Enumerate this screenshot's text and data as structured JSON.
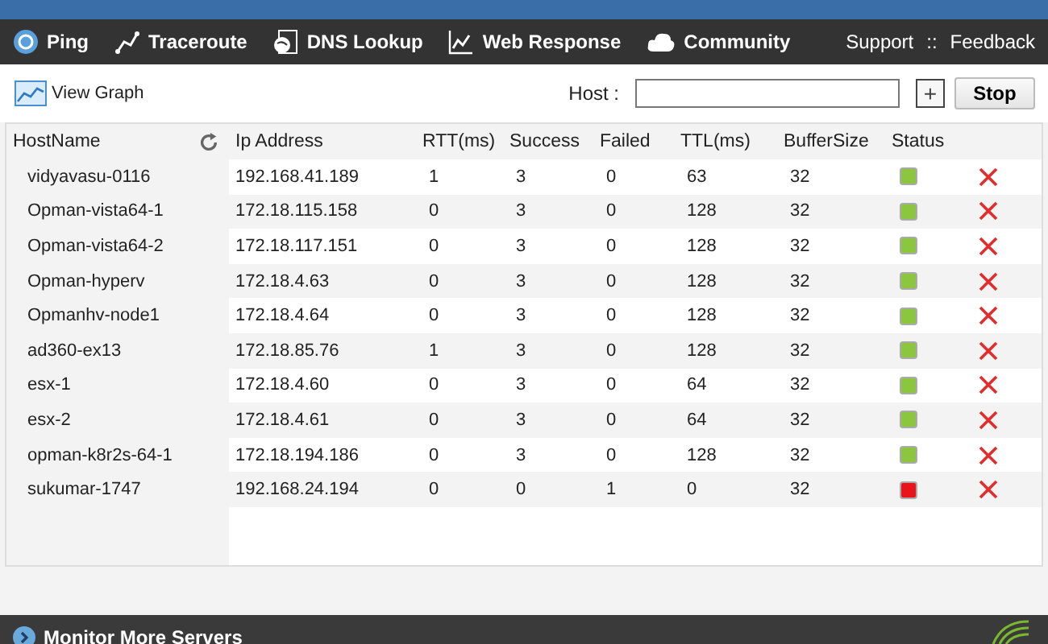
{
  "nav": {
    "items": [
      {
        "label": "Ping"
      },
      {
        "label": "Traceroute"
      },
      {
        "label": "DNS Lookup"
      },
      {
        "label": "Web Response"
      },
      {
        "label": "Community"
      }
    ],
    "links": [
      "Support",
      "::",
      "Feedback"
    ]
  },
  "toolbar": {
    "view_graph": "View Graph",
    "host_label": "Host :",
    "add": "+",
    "stop": "Stop"
  },
  "table": {
    "columns": [
      "HostName",
      "Ip Address",
      "RTT(ms)",
      "Success",
      "Failed",
      "TTL(ms)",
      "BufferSize",
      "Status"
    ],
    "rows": [
      {
        "host": "vidyavasu-0116",
        "ip": "192.168.41.189",
        "rtt": "1",
        "success": "3",
        "failed": "0",
        "ttl": "63",
        "buffer": "32",
        "color": "#8cc63f"
      },
      {
        "host": "Opman-vista64-1",
        "ip": "172.18.115.158",
        "rtt": "0",
        "success": "3",
        "failed": "0",
        "ttl": "128",
        "buffer": "32",
        "color": "#8cc63f"
      },
      {
        "host": "Opman-vista64-2",
        "ip": "172.18.117.151",
        "rtt": "0",
        "success": "3",
        "failed": "0",
        "ttl": "128",
        "buffer": "32",
        "color": "#8cc63f"
      },
      {
        "host": "Opman-hyperv",
        "ip": "172.18.4.63",
        "rtt": "0",
        "success": "3",
        "failed": "0",
        "ttl": "128",
        "buffer": "32",
        "color": "#8cc63f"
      },
      {
        "host": "Opmanhv-node1",
        "ip": "172.18.4.64",
        "rtt": "0",
        "success": "3",
        "failed": "0",
        "ttl": "128",
        "buffer": "32",
        "color": "#8cc63f"
      },
      {
        "host": "ad360-ex13",
        "ip": "172.18.85.76",
        "rtt": "1",
        "success": "3",
        "failed": "0",
        "ttl": "128",
        "buffer": "32",
        "color": "#8cc63f"
      },
      {
        "host": "esx-1",
        "ip": "172.18.4.60",
        "rtt": "0",
        "success": "3",
        "failed": "0",
        "ttl": "64",
        "buffer": "32",
        "color": "#8cc63f"
      },
      {
        "host": "esx-2",
        "ip": "172.18.4.61",
        "rtt": "0",
        "success": "3",
        "failed": "0",
        "ttl": "64",
        "buffer": "32",
        "color": "#8cc63f"
      },
      {
        "host": "opman-k8r2s-64-1",
        "ip": "172.18.194.186",
        "rtt": "0",
        "success": "3",
        "failed": "0",
        "ttl": "128",
        "buffer": "32",
        "color": "#8cc63f"
      },
      {
        "host": "sukumar-1747",
        "ip": "192.168.24.194",
        "rtt": "0",
        "success": "0",
        "failed": "1",
        "ttl": "0",
        "buffer": "32",
        "color": "#e8141b"
      }
    ]
  },
  "footer": {
    "label": "Monitor More Servers"
  }
}
